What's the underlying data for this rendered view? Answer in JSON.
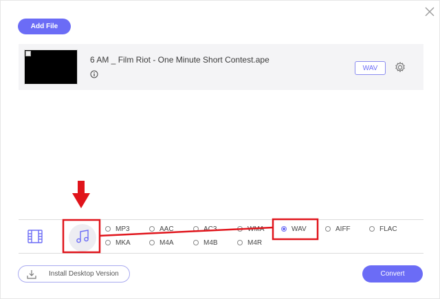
{
  "toolbar": {
    "add_file_label": "Add File"
  },
  "file": {
    "name": "6 AM _ Film Riot - One Minute Short Contest.ape",
    "output_format": "WAV"
  },
  "formats": {
    "row1": [
      "MP3",
      "AAC",
      "AC3",
      "WMA",
      "WAV",
      "AIFF",
      "FLAC"
    ],
    "row2": [
      "MKA",
      "M4A",
      "M4B",
      "M4R"
    ],
    "selected": "WAV"
  },
  "footer": {
    "install_label": "Install Desktop Version",
    "convert_label": "Convert"
  },
  "colors": {
    "accent": "#6b6cf6",
    "annotation": "#e0141b"
  },
  "icons": [
    "close-icon",
    "info-icon",
    "gear-icon",
    "film-icon",
    "music-note-icon",
    "download-icon",
    "arrow-down-icon"
  ]
}
